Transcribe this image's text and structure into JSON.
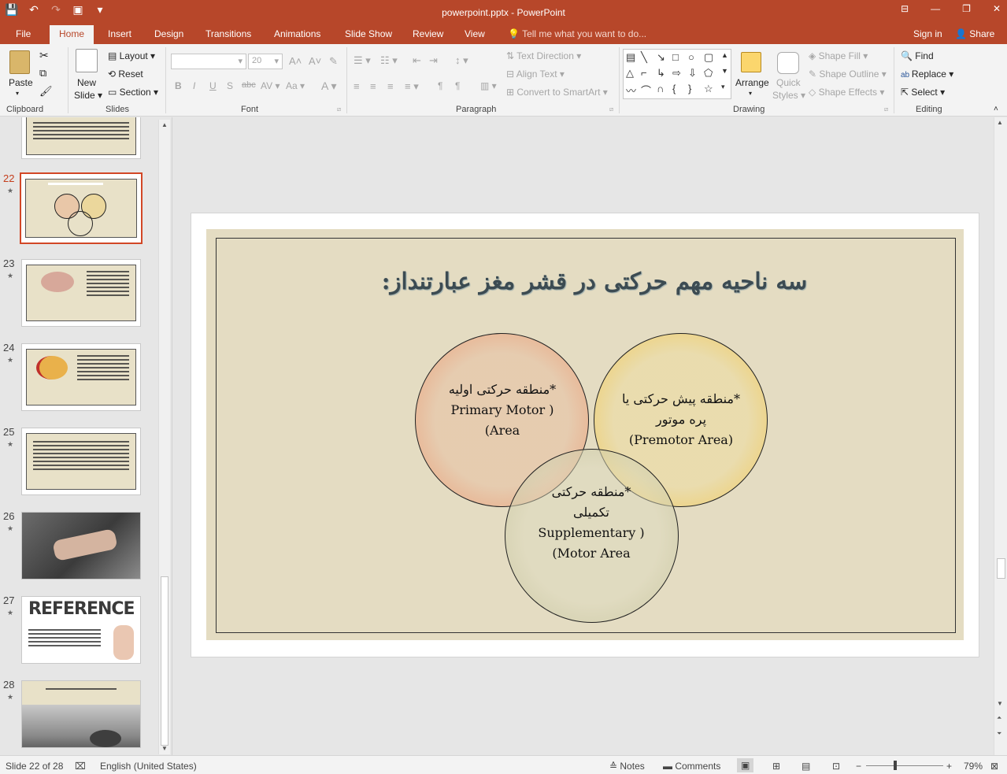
{
  "window": {
    "title": "powerpoint.pptx - PowerPoint",
    "controls": [
      "⊟",
      "—",
      "❐",
      "✕"
    ]
  },
  "qat": {
    "save": "💾",
    "undo": "↶",
    "redo": "↷",
    "present": "▣",
    "more": "▾"
  },
  "tabs": [
    "File",
    "Home",
    "Insert",
    "Design",
    "Transitions",
    "Animations",
    "Slide Show",
    "Review",
    "View"
  ],
  "active_tab": "Home",
  "tell_me": "Tell me what you want to do...",
  "sign_in": "Sign in",
  "share": "Share",
  "ribbon": {
    "clipboard": {
      "label": "Clipboard",
      "paste": "Paste"
    },
    "slides": {
      "label": "Slides",
      "new_slide_1": "New",
      "new_slide_2": "Slide",
      "layout": "Layout",
      "reset": "Reset",
      "section": "Section"
    },
    "font": {
      "label": "Font",
      "size": "20"
    },
    "paragraph": {
      "label": "Paragraph",
      "text_direction": "Text Direction",
      "align_text": "Align Text",
      "convert_smartart": "Convert to SmartArt"
    },
    "drawing": {
      "label": "Drawing",
      "arrange": "Arrange",
      "quick_styles_1": "Quick",
      "quick_styles_2": "Styles",
      "shape_fill": "Shape Fill",
      "shape_outline": "Shape Outline",
      "shape_effects": "Shape Effects"
    },
    "editing": {
      "label": "Editing",
      "find": "Find",
      "replace": "Replace",
      "select": "Select"
    }
  },
  "thumbnails": [
    {
      "num": "22",
      "selected": true
    },
    {
      "num": "23",
      "selected": false
    },
    {
      "num": "24",
      "selected": false
    },
    {
      "num": "25",
      "selected": false
    },
    {
      "num": "26",
      "selected": false
    },
    {
      "num": "27",
      "selected": false,
      "text": "REFERENCE"
    },
    {
      "num": "28",
      "selected": false
    }
  ],
  "slide": {
    "title": "سه ناحیه مهم حرکتی در قشر مغز عبارتنداز:",
    "circle1": {
      "line1": "*منطقه حرکتی اولیه",
      "line2": "Primary Motor )",
      "line3": "(Area"
    },
    "circle2": {
      "line1": "*منطقه پیش حرکتی یا",
      "line2": "پره موتور",
      "line3": "(Premotor Area)"
    },
    "circle3": {
      "line1": "*منطقه حرکتی",
      "line2": "تکمیلی",
      "line3": "Supplementary )",
      "line4": "(Motor Area"
    }
  },
  "status": {
    "slide_of": "Slide 22 of 28",
    "language": "English (United States)",
    "notes": "Notes",
    "comments": "Comments",
    "zoom": "79%"
  }
}
